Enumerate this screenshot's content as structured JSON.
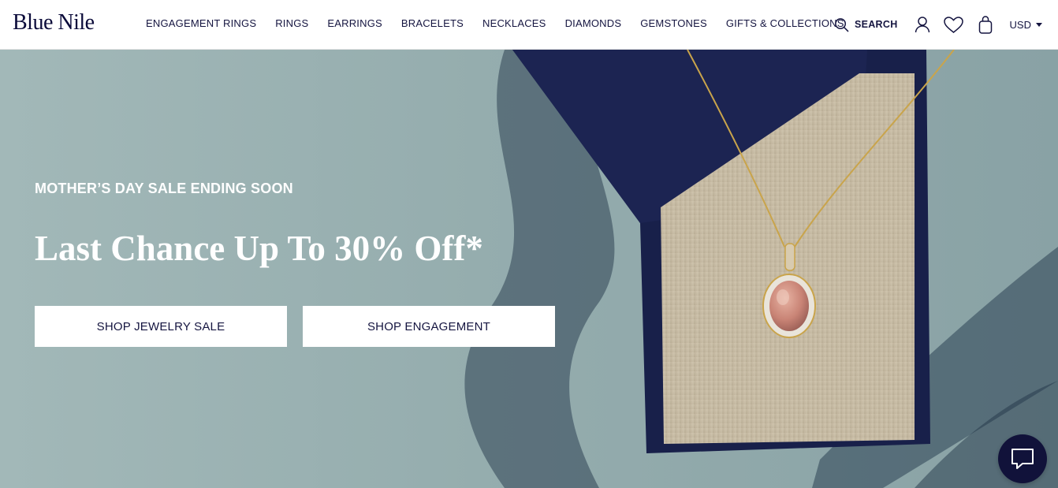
{
  "brand": {
    "name": "Blue Nile"
  },
  "nav": {
    "items": [
      {
        "label": "ENGAGEMENT RINGS"
      },
      {
        "label": "RINGS"
      },
      {
        "label": "EARRINGS"
      },
      {
        "label": "BRACELETS"
      },
      {
        "label": "NECKLACES"
      },
      {
        "label": "DIAMONDS"
      },
      {
        "label": "GEMSTONES"
      },
      {
        "label": "GIFTS & COLLECTIONS"
      }
    ]
  },
  "utilities": {
    "search_label": "SEARCH",
    "currency": "USD",
    "icons": [
      "search-icon",
      "account-icon",
      "wishlist-heart-icon",
      "shopping-bag-icon",
      "chevron-down-icon"
    ]
  },
  "hero": {
    "eyebrow": "MOTHER’S DAY SALE ENDING SOON",
    "headline": "Last Chance Up To 30% Off*",
    "buttons": [
      {
        "label": "SHOP JEWELRY SALE"
      },
      {
        "label": "SHOP ENGAGEMENT"
      }
    ]
  },
  "chat": {
    "icon": "chat-bubble-icon"
  },
  "colors": {
    "brand_navy": "#0b0b3a",
    "chat_bg": "#11123a",
    "hero_bg": "#95adae",
    "button_bg": "#ffffff"
  }
}
